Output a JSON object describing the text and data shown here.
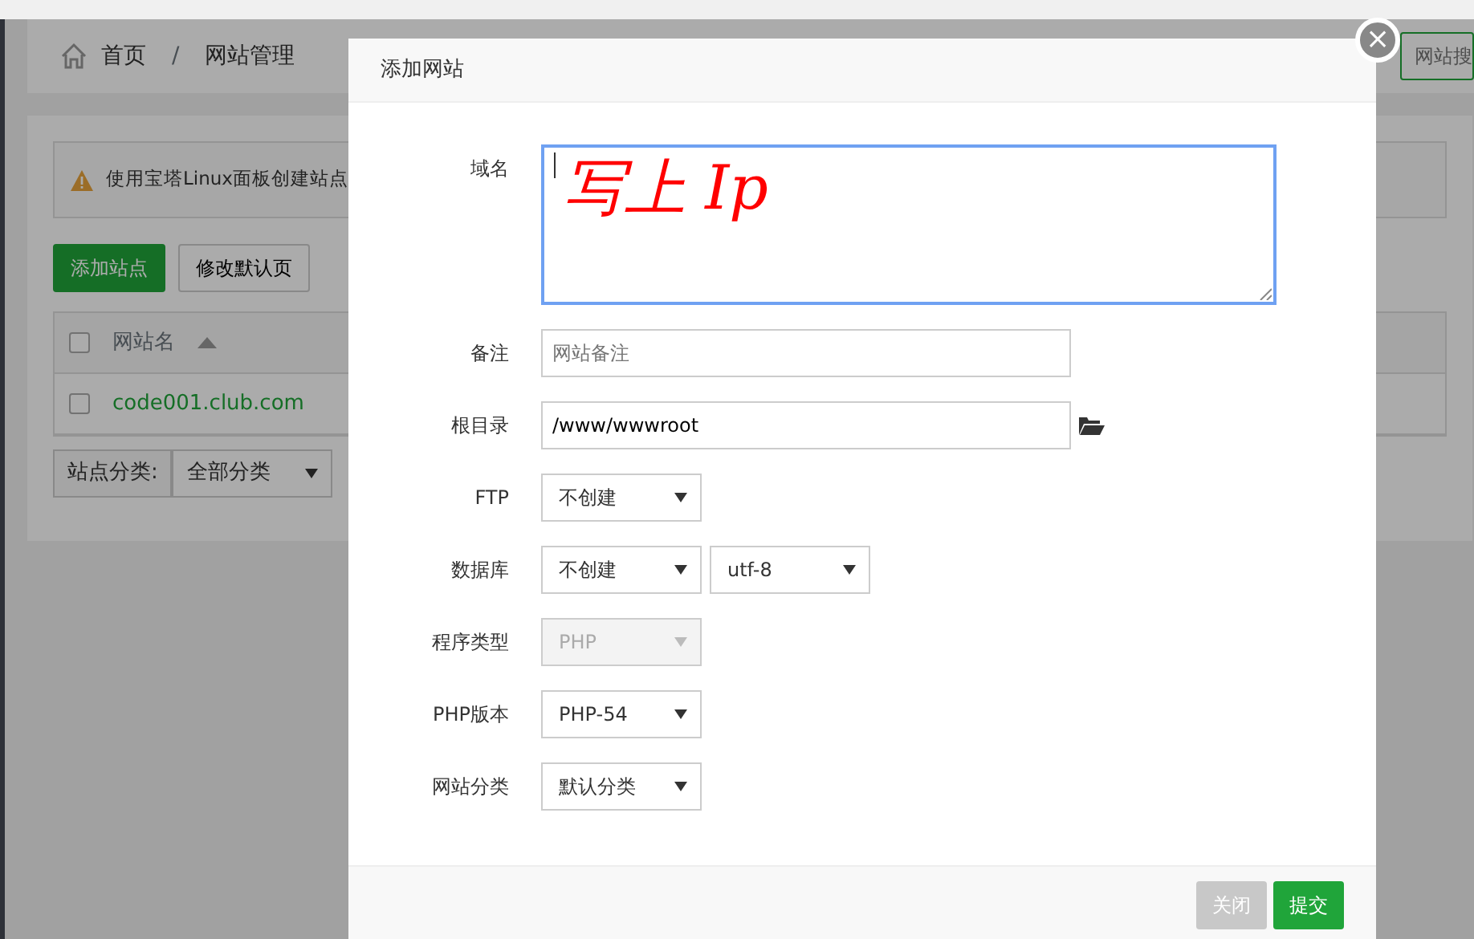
{
  "breadcrumb": {
    "home": "首页",
    "separator": "/",
    "current": "网站管理"
  },
  "search_button": "网站搜",
  "alert": "使用宝塔Linux面板创建站点",
  "toolbar": [
    "添加站点",
    "修改默认页"
  ],
  "table": {
    "select_all": false,
    "columns": [
      "网站名"
    ],
    "rows": [
      {
        "name": "code001.club.com",
        "checked": false
      }
    ]
  },
  "filter": {
    "label": "站点分类:",
    "value": "全部分类"
  },
  "dialog": {
    "title": "添加网站",
    "close": "×",
    "fields": [
      {
        "kind": "textarea",
        "label": "域名",
        "focused": true,
        "annotation": "写上 Ip"
      },
      {
        "kind": "input",
        "label": "备注",
        "placeholder": "网站备注"
      },
      {
        "kind": "path",
        "label": "根目录",
        "value": "/www/wwwroot"
      },
      {
        "kind": "select",
        "label": "FTP",
        "values": [
          "不创建"
        ],
        "disabled": false
      },
      {
        "kind": "select",
        "label": "数据库",
        "values": [
          "不创建",
          "utf-8"
        ],
        "disabled": false
      },
      {
        "kind": "select",
        "label": "程序类型",
        "values": [
          "PHP"
        ],
        "disabled": true
      },
      {
        "kind": "select",
        "label": "PHP版本",
        "values": [
          "PHP-54"
        ],
        "disabled": false
      },
      {
        "kind": "select",
        "label": "网站分类",
        "values": [
          "默认分类"
        ],
        "disabled": false
      }
    ],
    "buttons": [
      {
        "label": "关闭",
        "kind": "secondary"
      },
      {
        "label": "提交",
        "kind": "primary"
      }
    ]
  }
}
